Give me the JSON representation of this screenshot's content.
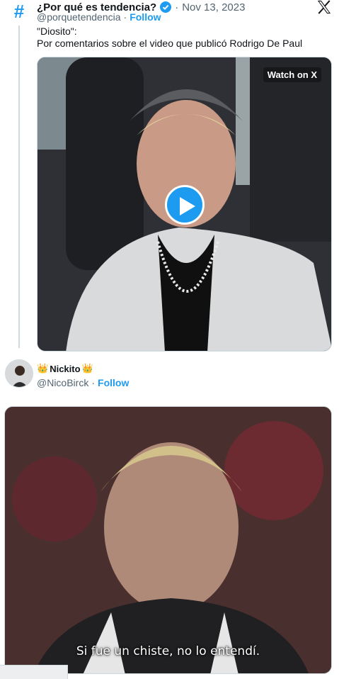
{
  "quoted_tweet": {
    "display_name": "¿Por qué es tendencia?",
    "date": "Nov 13, 2023",
    "handle": "@porquetendencia",
    "follow_label": "Follow",
    "text_line1": "\"Diosito\":",
    "text_line2": "Por comentarios sobre el video que publicó Rodrigo De Paul",
    "video_badge": "Watch on X",
    "avatar_icon": "hashtag-icon",
    "brand_color": "#1d9bf0"
  },
  "reply_tweet": {
    "display_name": "Nickito",
    "handle": "@NicoBirck",
    "follow_label": "Follow",
    "caption": "Si fue un chiste, no lo entendí."
  },
  "separators": {
    "dot": "·"
  }
}
